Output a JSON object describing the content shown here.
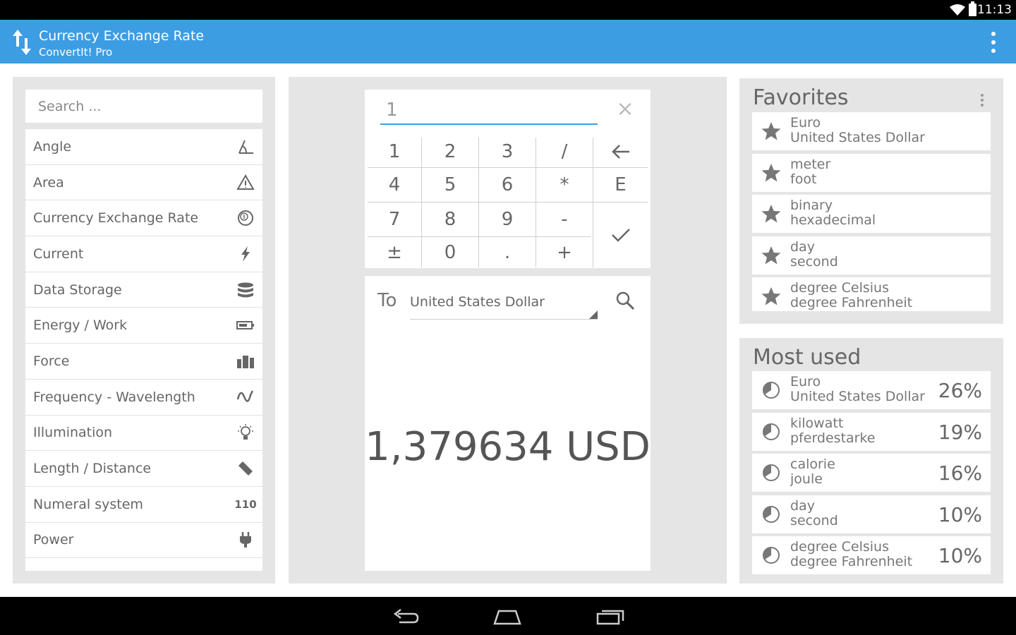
{
  "status_bar": {
    "time": "11:13"
  },
  "app_bar": {
    "title": "Currency Exchange Rate",
    "subtitle": "ConvertIt! Pro"
  },
  "search": {
    "placeholder": "Search ..."
  },
  "categories": [
    {
      "label": "Angle",
      "icon": "angle-icon"
    },
    {
      "label": "Area",
      "icon": "area-icon"
    },
    {
      "label": "Currency Exchange Rate",
      "icon": "currency-icon"
    },
    {
      "label": "Current",
      "icon": "lightning-icon"
    },
    {
      "label": "Data Storage",
      "icon": "database-icon"
    },
    {
      "label": "Energy / Work",
      "icon": "battery-icon"
    },
    {
      "label": "Force",
      "icon": "weight-icon"
    },
    {
      "label": "Frequency - Wavelength",
      "icon": "wave-icon"
    },
    {
      "label": "Illumination",
      "icon": "bulb-icon"
    },
    {
      "label": "Length / Distance",
      "icon": "ruler-icon"
    },
    {
      "label": "Numeral system",
      "icon": "numeral-icon",
      "icon_text": "110"
    },
    {
      "label": "Power",
      "icon": "plug-icon"
    }
  ],
  "calculator": {
    "input_value": "1",
    "keys": {
      "k1": "1",
      "k2": "2",
      "k3": "3",
      "kdiv": "/",
      "k4": "4",
      "k5": "5",
      "k6": "6",
      "kmul": "*",
      "kexp": "E",
      "k7": "7",
      "k8": "8",
      "k9": "9",
      "ksub": "-",
      "kneg": "±",
      "k0": "0",
      "kdot": ".",
      "kadd": "+"
    }
  },
  "result": {
    "to_label": "To",
    "to_unit": "United States Dollar",
    "value": "1,379634 USD"
  },
  "favorites": {
    "title": "Favorites",
    "items": [
      {
        "from": "Euro",
        "to": "United States Dollar"
      },
      {
        "from": "meter",
        "to": "foot"
      },
      {
        "from": "binary",
        "to": "hexadecimal"
      },
      {
        "from": "day",
        "to": "second"
      },
      {
        "from": "degree Celsius",
        "to": "degree Fahrenheit"
      }
    ]
  },
  "most_used": {
    "title": "Most used",
    "items": [
      {
        "from": "Euro",
        "to": "United States Dollar",
        "percent": "26%"
      },
      {
        "from": "kilowatt",
        "to": "pferdestarke",
        "percent": "19%"
      },
      {
        "from": "calorie",
        "to": "joule",
        "percent": "16%"
      },
      {
        "from": "day",
        "to": "second",
        "percent": "10%"
      },
      {
        "from": "degree Celsius",
        "to": "degree Fahrenheit",
        "percent": "10%"
      }
    ]
  },
  "colors": {
    "accent": "#3d9de3",
    "panel_bg": "#e5e5e5"
  }
}
